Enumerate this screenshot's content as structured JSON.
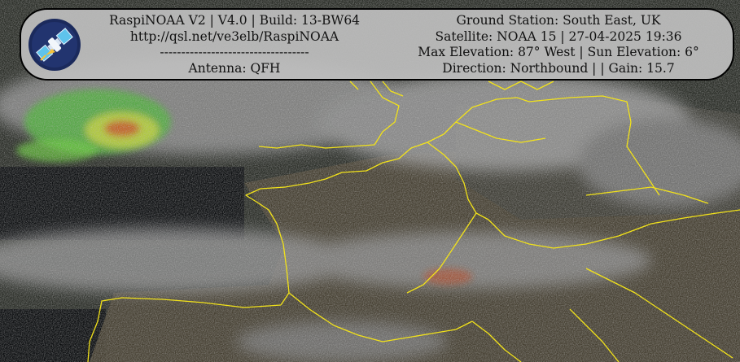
{
  "header": {
    "left_lines": [
      "RaspiNOAA V2 | V4.0 | Build: 13-BW64",
      "http://qsl.net/ve3elb/RaspiNOAA",
      "-----------------------------------",
      "Antenna: QFH"
    ],
    "right_lines": [
      "Ground Station: South East, UK",
      "Satellite: NOAA 15 | 27-04-2025 19:36",
      "Max Elevation: 87° West | Sun Elevation: 6°",
      "Direction: Northbound | | Gain: 15.7"
    ]
  },
  "logo": {
    "icon": "satellite-icon"
  },
  "colors": {
    "overlay_bg": "#bebebe",
    "coastline": "#f2e21a",
    "logo_ring": "#1b2a5c"
  }
}
